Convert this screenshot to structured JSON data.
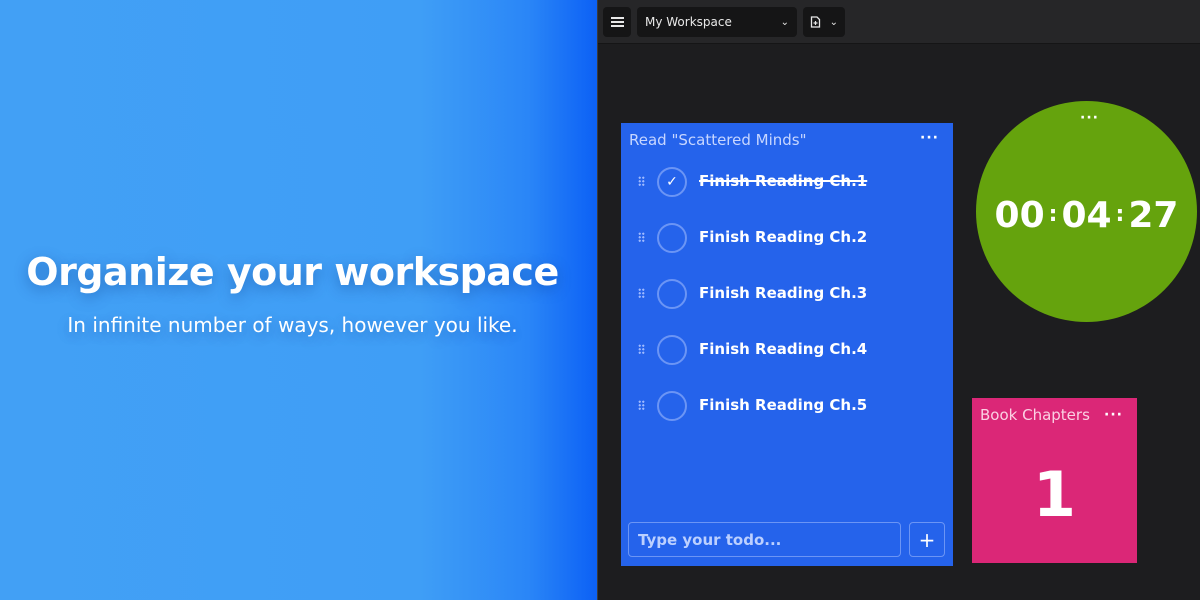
{
  "promo": {
    "title": "Organize your workspace",
    "subtitle": "In infinite number of ways, however you like."
  },
  "toolbar": {
    "menu_icon": "hamburger-menu-icon",
    "workspace_selected": "My Workspace",
    "doc_icon": "document-icon",
    "chevron_icon": "chevron-down-icon"
  },
  "todo_widget": {
    "title": "Read \"Scattered Minds\"",
    "menu_icon": "more-horizontal-icon",
    "items": [
      {
        "label": "Finish Reading Ch.1",
        "done": true
      },
      {
        "label": "Finish Reading Ch.2",
        "done": false
      },
      {
        "label": "Finish Reading Ch.3",
        "done": false
      },
      {
        "label": "Finish Reading Ch.4",
        "done": false
      },
      {
        "label": "Finish Reading Ch.5",
        "done": false
      }
    ],
    "input_placeholder": "Type your todo...",
    "add_label": "+"
  },
  "timer_widget": {
    "hours": "00",
    "minutes": "04",
    "seconds": "27",
    "separator": ":",
    "menu_icon": "more-horizontal-icon"
  },
  "counter_widget": {
    "title": "Book Chapters",
    "value": "1",
    "menu_icon": "more-horizontal-icon"
  },
  "colors": {
    "promo_bg": "#42a0f5",
    "app_bg": "#1d1d1f",
    "todo_bg": "#2563eb",
    "timer_bg": "#65a30d",
    "counter_bg": "#db2777"
  }
}
